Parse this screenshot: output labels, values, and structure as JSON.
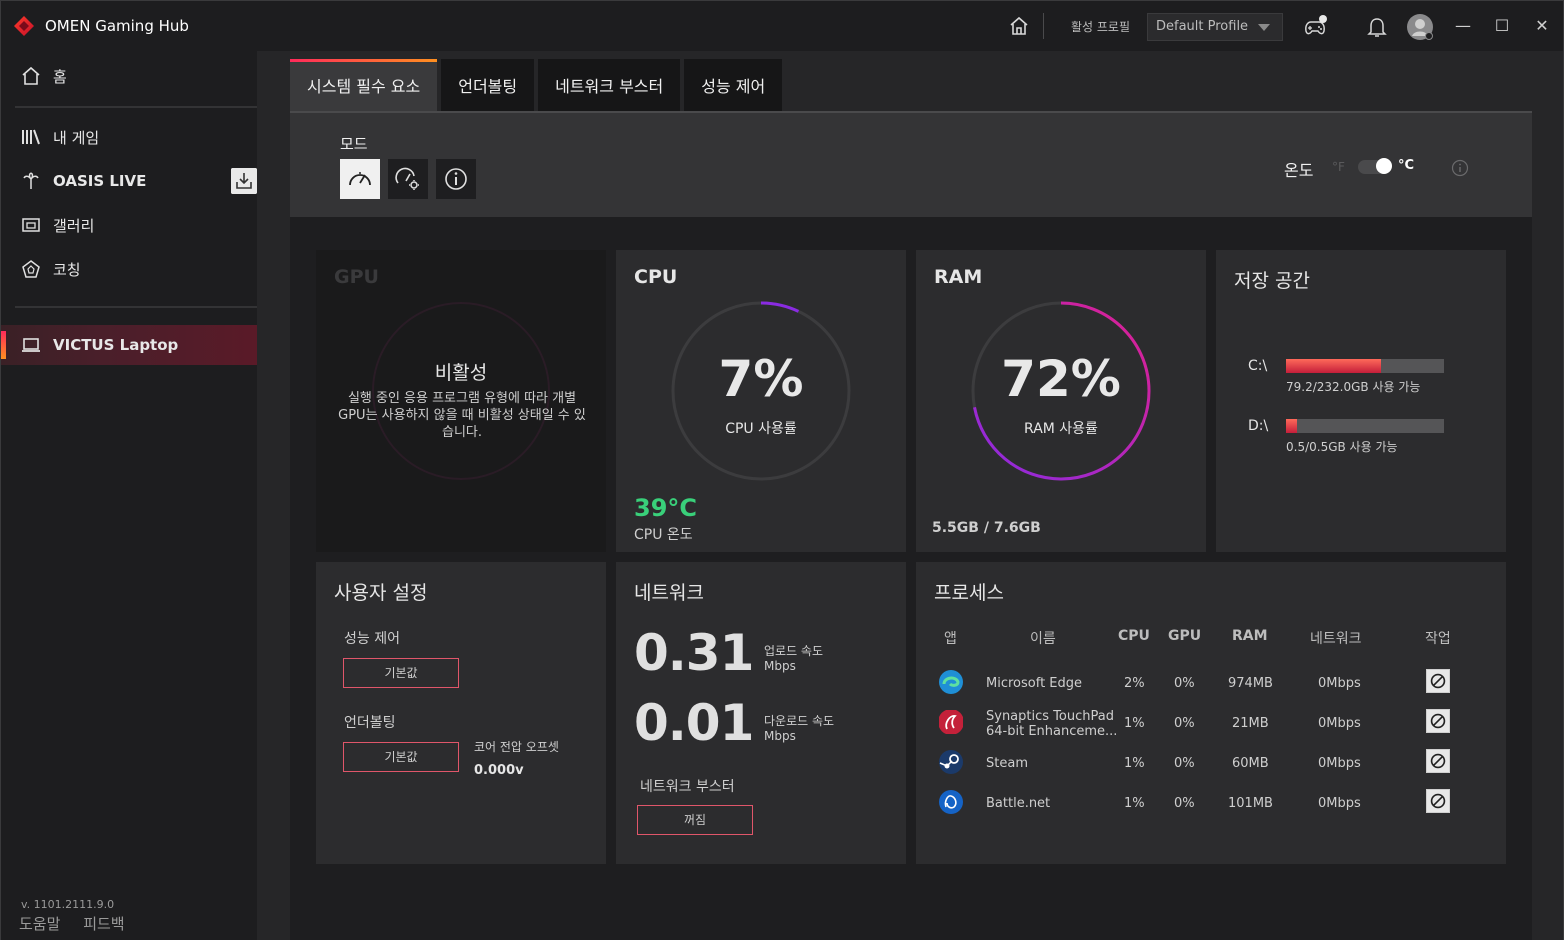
{
  "app": {
    "title": "OMEN Gaming Hub"
  },
  "titlebar": {
    "profile_label": "활성 프로필",
    "profile_value": "Default Profile"
  },
  "sidebar": {
    "items": [
      {
        "label": "홈"
      },
      {
        "label": "내 게임"
      },
      {
        "label": "OASIS LIVE"
      },
      {
        "label": "갤러리"
      },
      {
        "label": "코칭"
      },
      {
        "label": "VICTUS Laptop"
      }
    ],
    "version": "v. 1101.2111.9.0",
    "help": "도움말",
    "feedback": "피드백"
  },
  "tabs": [
    {
      "label": "시스템 필수 요소"
    },
    {
      "label": "언더볼팅"
    },
    {
      "label": "네트워크 부스터"
    },
    {
      "label": "성능 제어"
    }
  ],
  "mode": {
    "label": "모드"
  },
  "temperature": {
    "label": "온도",
    "unit_f": "°F",
    "unit_c": "°C"
  },
  "gpu": {
    "title": "GPU",
    "status": "비활성",
    "desc": "실행 중인 응용 프로그램 유형에 따라 개별 GPU는 사용하지 않을 때 비활성 상태일 수 있습니다."
  },
  "cpu": {
    "title": "CPU",
    "usage": "7%",
    "usage_fraction": 0.07,
    "usage_label": "CPU 사용률",
    "temp": "39°C",
    "temp_label": "CPU 온도"
  },
  "ram": {
    "title": "RAM",
    "usage": "72%",
    "usage_fraction": 0.72,
    "usage_label": "RAM 사용률",
    "amount": "5.5GB / 7.6GB"
  },
  "storage": {
    "title": "저장 공간",
    "drives": [
      {
        "letter": "C:\\",
        "info": "79.2/232.0GB 사용 가능",
        "fill": 0.6
      },
      {
        "letter": "D:\\",
        "info": "0.5/0.5GB 사용 가능",
        "fill": 0.07
      }
    ]
  },
  "user_settings": {
    "title": "사용자 설정",
    "perf_label": "성능 제어",
    "perf_value": "기본값",
    "uv_label": "언더볼팅",
    "uv_value": "기본값",
    "offset_label": "코어 전압 오프셋",
    "offset_value": "0.000v"
  },
  "network": {
    "title": "네트워크",
    "upload": "0.31",
    "upload_label": "업로드 속도",
    "upload_unit": "Mbps",
    "download": "0.01",
    "download_label": "다운로드 속도",
    "download_unit": "Mbps",
    "booster_label": "네트워크 부스터",
    "booster_value": "꺼짐"
  },
  "processes": {
    "title": "프로세스",
    "headers": {
      "app": "앱",
      "name": "이름",
      "cpu": "CPU",
      "gpu": "GPU",
      "ram": "RAM",
      "net": "네트워크",
      "action": "작업"
    },
    "rows": [
      {
        "name": "Microsoft Edge",
        "name2": "",
        "cpu": "2%",
        "gpu": "0%",
        "ram": "974MB",
        "net": "0Mbps",
        "icon_color": "#1f8fd6"
      },
      {
        "name": "Synaptics TouchPad",
        "name2": "64-bit Enhanceme...",
        "cpu": "1%",
        "gpu": "0%",
        "ram": "21MB",
        "net": "0Mbps",
        "icon_color": "#c4213a"
      },
      {
        "name": "Steam",
        "name2": "",
        "cpu": "1%",
        "gpu": "0%",
        "ram": "60MB",
        "net": "0Mbps",
        "icon_color": "#1b3a6a"
      },
      {
        "name": "Battle.net",
        "name2": "",
        "cpu": "1%",
        "gpu": "0%",
        "ram": "101MB",
        "net": "0Mbps",
        "icon_color": "#1563c6"
      }
    ]
  }
}
